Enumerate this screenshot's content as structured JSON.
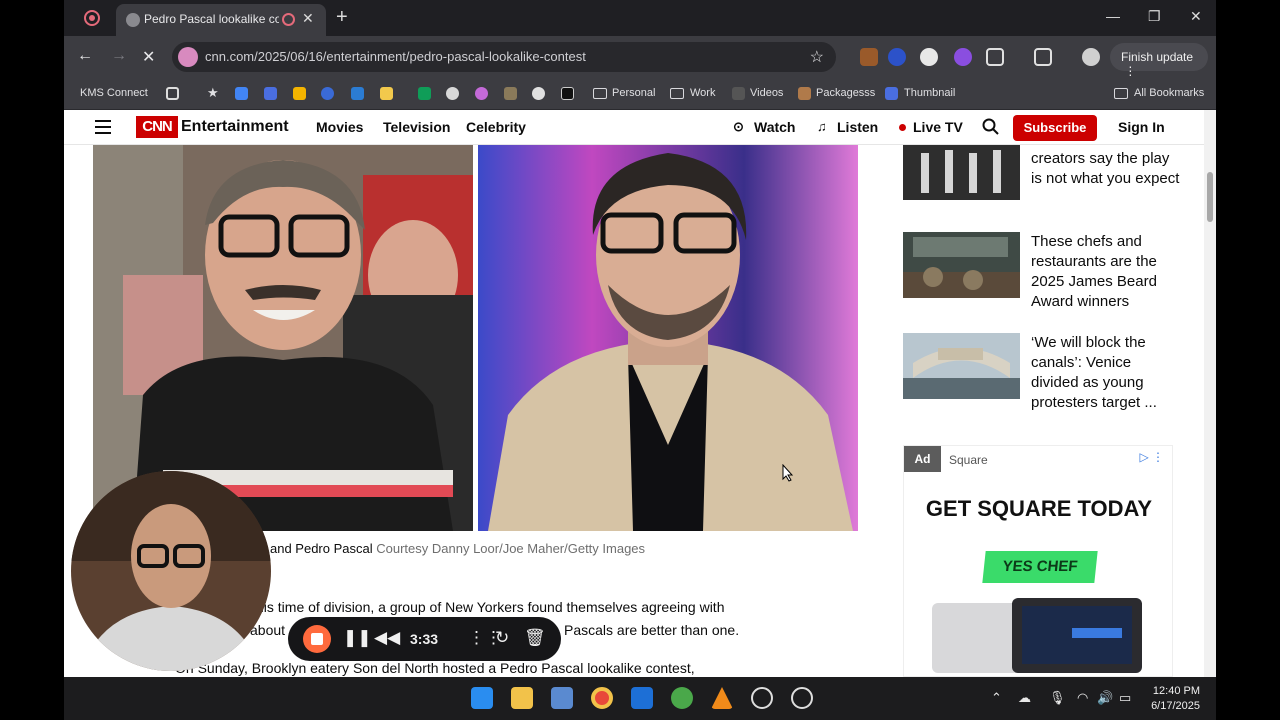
{
  "browser": {
    "tab_title": "Pedro Pascal lookalike contest",
    "url": "cnn.com/2025/06/16/entertainment/pedro-pascal-lookalike-contest",
    "finish_update": "Finish update",
    "bookmarks": [
      "KMS Connect",
      "Personal",
      "Work",
      "Videos",
      "Packagesss",
      "Thumbnail",
      "All Bookmarks"
    ]
  },
  "cnn": {
    "logo": "CNN",
    "section": "Entertainment",
    "nav": [
      "Movies",
      "Television",
      "Celebrity"
    ],
    "watch": "Watch",
    "listen": "Listen",
    "live_tv": "Live TV",
    "subscribe": "Subscribe",
    "sign_in": "Sign In"
  },
  "article": {
    "caption_names": "and Pedro Pascal",
    "caption_credit": "Courtesy Danny Loor/Joe Maher/Getty Images",
    "para1_line1": "his time of division, a group of New Yorkers found themselves agreeing with",
    "para1_line2_left": "about",
    "para1_line2_right": "Pascals are better than one.",
    "para2_line1": "On Sunday, Brooklyn eatery Son del North hosted a Pedro Pascal lookalike contest,"
  },
  "sidebar": {
    "items": [
      {
        "title": "creators say the play is not what you expect"
      },
      {
        "title": "These chefs and restaurants are the 2025 James Beard Award winners"
      },
      {
        "title": "‘We will block the canals’: Venice divided as young protesters target ..."
      }
    ],
    "ad": {
      "tag": "Ad",
      "brand": "Square",
      "headline": "GET SQUARE TODAY",
      "cta": "YES CHEF"
    }
  },
  "recorder": {
    "time": "3:33"
  },
  "system": {
    "time": "12:40 PM",
    "date": "6/17/2025"
  }
}
